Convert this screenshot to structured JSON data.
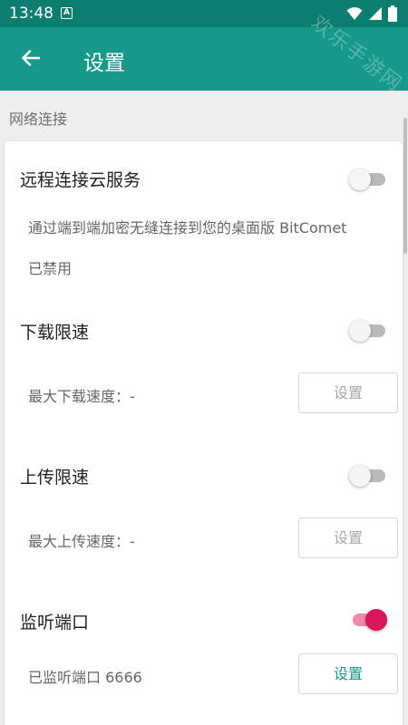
{
  "status_bar": {
    "time": "13:48",
    "notification_letter": "A",
    "icons": [
      "a-notification-icon",
      "wifi-icon",
      "cell-signal-icon",
      "battery-icon"
    ]
  },
  "app_bar": {
    "title": "设置",
    "back_icon": "arrow-left-icon"
  },
  "section": {
    "header": "网络连接"
  },
  "settings": {
    "remote": {
      "title": "远程连接云服务",
      "description": "通过端到端加密无缝连接到您的桌面版 BitComet",
      "status": "已禁用",
      "enabled": false
    },
    "download_limit": {
      "title": "下载限速",
      "description": "最大下载速度：-",
      "button_label": "设置",
      "enabled": false
    },
    "upload_limit": {
      "title": "上传限速",
      "description": "最大上传速度：-",
      "button_label": "设置",
      "enabled": false
    },
    "listen_port": {
      "title": "监听端口",
      "description": "已监听端口 6666",
      "button_label": "设置",
      "enabled": true
    }
  },
  "watermark": "欢乐手游网",
  "colors": {
    "status_bar": "#0c7e70",
    "app_bar": "#16988a",
    "switch_on_thumb": "#d8175a",
    "switch_on_track": "#f08aa6",
    "switch_off_track": "#b9b9b9",
    "button_enabled_text": "#16988a",
    "button_disabled_text": "#a8a8a8"
  }
}
